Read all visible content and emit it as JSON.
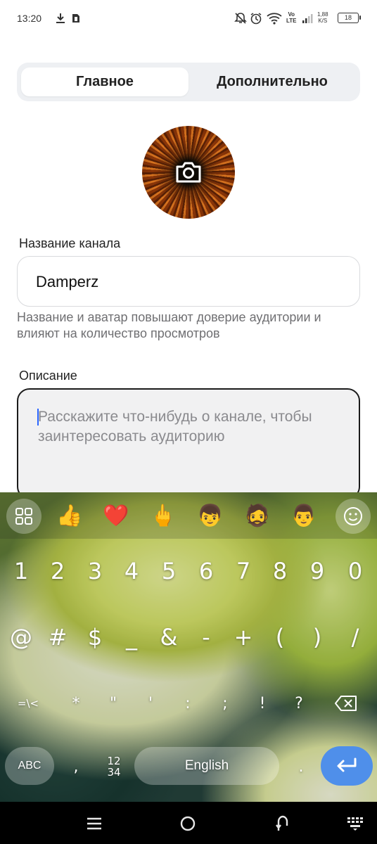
{
  "status_bar": {
    "time": "13:20",
    "network_type": "Vo\nLTE",
    "net_speed": "1,88\nK/S",
    "battery": "18",
    "icons": [
      "download-icon",
      "sim-icon",
      "mute-icon",
      "alarm-icon",
      "wifi-icon",
      "signal-icon",
      "battery-icon"
    ]
  },
  "tabs": {
    "main": "Главное",
    "extra": "Дополнительно",
    "active": "main"
  },
  "avatar": {
    "icon": "camera-icon"
  },
  "channel_name": {
    "label": "Название канала",
    "value": "Damperz",
    "helper": "Название и аватар повышают доверие аудитории и влияют на количество просмотров"
  },
  "description": {
    "label": "Описание",
    "placeholder": "Расскажите что-нибудь о канале, чтобы заинтересовать аудиторию"
  },
  "keyboard": {
    "emoji_bar": [
      "👍",
      "❤️",
      "🖕",
      "👦",
      "🧔",
      "👨"
    ],
    "row_numbers": [
      "1",
      "2",
      "3",
      "4",
      "5",
      "6",
      "7",
      "8",
      "9",
      "0"
    ],
    "row_symbols1": [
      "@",
      "#",
      "$",
      "_",
      "&",
      "-",
      "+",
      "(",
      ")",
      "/"
    ],
    "row_symbols2": [
      "=\\<",
      "*",
      "\"",
      "'",
      ":",
      ";",
      "!",
      "?"
    ],
    "abc_label": "ABC",
    "comma": ",",
    "numpad_label_top": "12",
    "numpad_label_bottom": "34",
    "space_label": "English",
    "period": ".",
    "accent_color": "#4f8fea"
  },
  "nav_bar": {
    "icons": [
      "menu-icon",
      "home-icon",
      "back-icon",
      "keyboard-toggle-icon"
    ]
  }
}
